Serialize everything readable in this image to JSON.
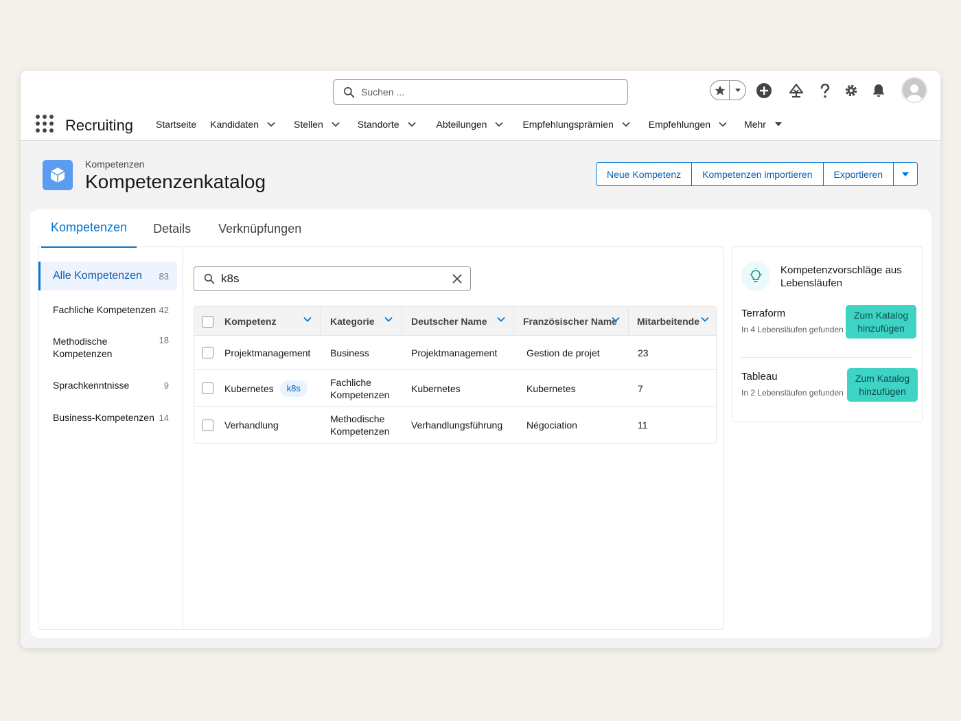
{
  "header": {
    "search_placeholder": "Suchen ...",
    "app_name": "Recruiting",
    "nav": [
      {
        "label": "Startseite",
        "dropdown": false
      },
      {
        "label": "Kandidaten",
        "dropdown": true
      },
      {
        "label": "Stellen",
        "dropdown": true
      },
      {
        "label": "Standorte",
        "dropdown": true
      },
      {
        "label": "Abteilungen",
        "dropdown": true
      },
      {
        "label": "Empfehlungsprämien",
        "dropdown": true
      },
      {
        "label": "Empfehlungen",
        "dropdown": true
      },
      {
        "label": "Mehr",
        "dropdown": true
      }
    ]
  },
  "page": {
    "eyebrow": "Kompetenzen",
    "title": "Kompetenzenkatalog",
    "actions": [
      "Neue Kompetenz",
      "Kompetenzen importieren",
      "Exportieren"
    ]
  },
  "tabs": [
    "Kompetenzen",
    "Details",
    "Verknüpfungen"
  ],
  "sidebar": [
    {
      "label": "Alle Kompetenzen",
      "count": "83"
    },
    {
      "label": "Fachliche Kompetenzen",
      "count": "42"
    },
    {
      "label": "Methodische Kompetenzen",
      "count": "18"
    },
    {
      "label": "Sprachkenntnisse",
      "count": "9"
    },
    {
      "label": "Business-Kompetenzen",
      "count": "14"
    }
  ],
  "filter": {
    "value": "k8s"
  },
  "table": {
    "columns": [
      "Kompetenz",
      "Kategorie",
      "Deutscher Name",
      "Französischer Name",
      "Mitarbeitende"
    ],
    "rows": [
      {
        "kompetenz": "Projektmanagement",
        "tag": "",
        "kategorie": "Business",
        "deutsch": "Projektmanagement",
        "franz": "Gestion de projet",
        "mitarbeitende": "23"
      },
      {
        "kompetenz": "Kubernetes",
        "tag": "k8s",
        "kategorie": "Fachliche Kompetenzen",
        "deutsch": "Kubernetes",
        "franz": "Kubernetes",
        "mitarbeitende": "7"
      },
      {
        "kompetenz": "Verhandlung",
        "tag": "",
        "kategorie": "Methodische Kompetenzen",
        "deutsch": "Verhandlungsführung",
        "franz": "Négociation",
        "mitarbeitende": "11"
      }
    ]
  },
  "suggestions": {
    "title": "Kompetenzvorschläge aus Lebensläufen",
    "items": [
      {
        "name": "Terraform",
        "sub": "In 4 Lebensläufen gefunden",
        "button": "Zum Katalog hinzufügen"
      },
      {
        "name": "Tableau",
        "sub": "In 2 Lebensläufen gefunden",
        "button": "Zum Katalog hinzufügen"
      }
    ]
  },
  "colors": {
    "accent": "#0176d3",
    "suggest_button": "#3ed3c5",
    "page_icon": "#5a9cf0"
  }
}
